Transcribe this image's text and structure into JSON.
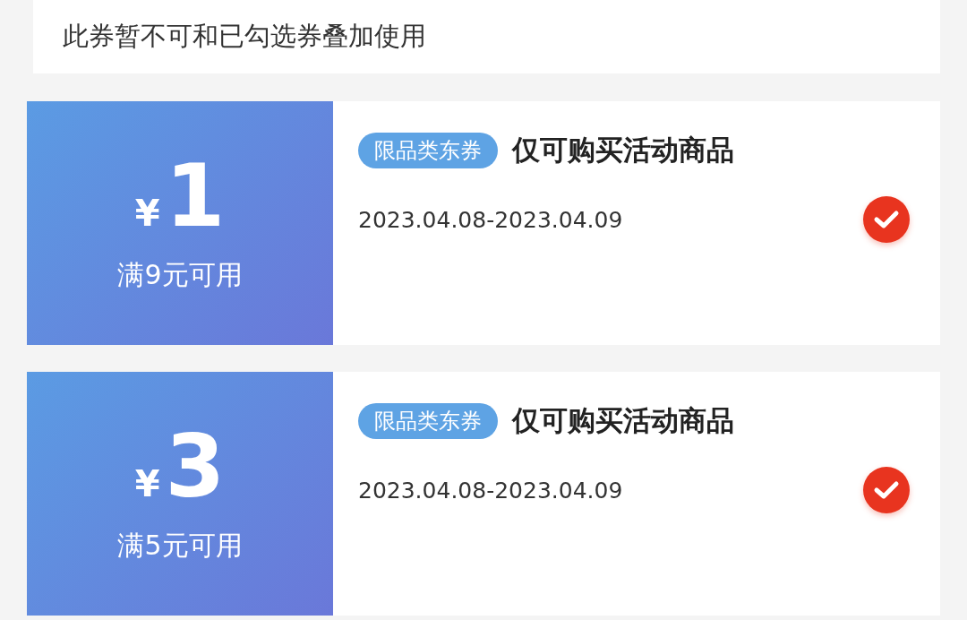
{
  "notice": "此券暂不可和已勾选券叠加使用",
  "coupons": [
    {
      "currency": "¥",
      "amount": "1",
      "condition": "满9元可用",
      "tag": "限品类东券",
      "title": "仅可购买活动商品",
      "validity": "2023.04.08-2023.04.09",
      "checked": true
    },
    {
      "currency": "¥",
      "amount": "3",
      "condition": "满5元可用",
      "tag": "限品类东券",
      "title": "仅可购买活动商品",
      "validity": "2023.04.08-2023.04.09",
      "checked": true
    }
  ]
}
